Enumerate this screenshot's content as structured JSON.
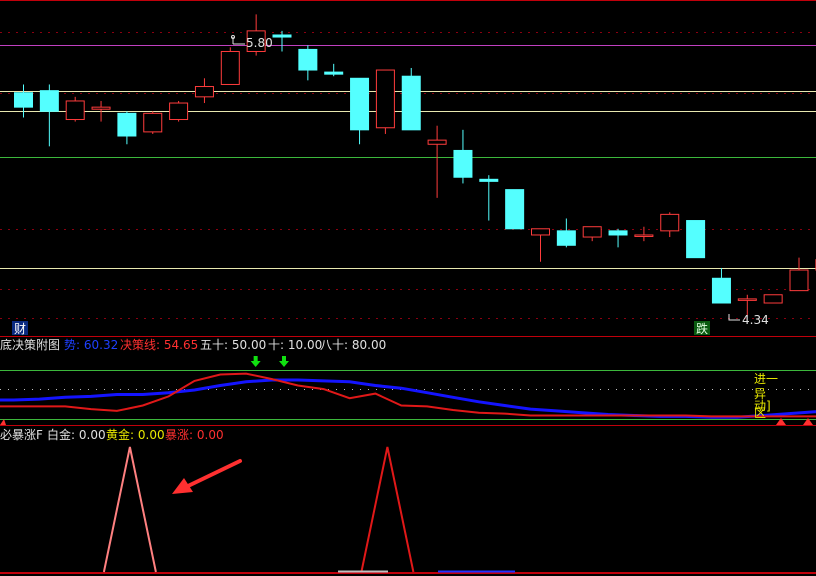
{
  "colors": {
    "background": "#000000",
    "frame": "#c0000b",
    "up": "#ff3c3c",
    "down": "#54ffff",
    "level_magenta": "#c040c0",
    "level_light": "#e8e8b0",
    "level_green": "#3cb83c",
    "blue_line": "#1414ff",
    "red_line": "#e01818",
    "pink_peak": "#ff8080",
    "arrow_green": "#10e010",
    "label_white": "#e0e0e0",
    "label_yellow": "#e8e800",
    "annotation_red": "#ff3030"
  },
  "price_panel": {
    "high_label": "5.80",
    "low_label": "4.34",
    "left_marker": "财",
    "right_marker": "跌"
  },
  "indicator1": {
    "name": "底决策附图",
    "line1_label": "势:",
    "line1_value": "60.32",
    "line2_label": "决策线:",
    "line2_value": "54.65",
    "level50_label": "五十:",
    "level50_value": "50.00",
    "level10_label": "十:",
    "level10_value": "10.00",
    "level80_label": "八十:",
    "level80_value": "80.00",
    "right_note": [
      "进一",
      "异",
      "动]",
      "区"
    ]
  },
  "indicator2": {
    "name": "必暴涨F",
    "baijin_label": "白金:",
    "baijin_value": "0.00",
    "huangjin_label": "黄金:",
    "huangjin_value": "0.00",
    "baozhang_label": "暴涨:",
    "baozhang_value": "0.00"
  },
  "chart_data": {
    "type": "candlestick",
    "candles": [
      {
        "o": 5.42,
        "h": 5.46,
        "l": 5.3,
        "c": 5.35
      },
      {
        "o": 5.43,
        "h": 5.46,
        "l": 5.16,
        "c": 5.33
      },
      {
        "o": 5.29,
        "h": 5.4,
        "l": 5.28,
        "c": 5.38
      },
      {
        "o": 5.34,
        "h": 5.38,
        "l": 5.28,
        "c": 5.35
      },
      {
        "o": 5.32,
        "h": 5.33,
        "l": 5.17,
        "c": 5.21
      },
      {
        "o": 5.23,
        "h": 5.33,
        "l": 5.22,
        "c": 5.32
      },
      {
        "o": 5.29,
        "h": 5.38,
        "l": 5.28,
        "c": 5.37
      },
      {
        "o": 5.4,
        "h": 5.49,
        "l": 5.37,
        "c": 5.45
      },
      {
        "o": 5.46,
        "h": 5.64,
        "l": 5.46,
        "c": 5.62
      },
      {
        "o": 5.62,
        "h": 5.8,
        "l": 5.6,
        "c": 5.72
      },
      {
        "o": 5.7,
        "h": 5.72,
        "l": 5.62,
        "c": 5.69
      },
      {
        "o": 5.63,
        "h": 5.65,
        "l": 5.48,
        "c": 5.53
      },
      {
        "o": 5.52,
        "h": 5.56,
        "l": 5.5,
        "c": 5.51
      },
      {
        "o": 5.49,
        "h": 5.49,
        "l": 5.17,
        "c": 5.24
      },
      {
        "o": 5.25,
        "h": 5.53,
        "l": 5.22,
        "c": 5.53
      },
      {
        "o": 5.5,
        "h": 5.54,
        "l": 5.24,
        "c": 5.24
      },
      {
        "o": 5.17,
        "h": 5.26,
        "l": 4.91,
        "c": 5.19
      },
      {
        "o": 5.14,
        "h": 5.24,
        "l": 4.98,
        "c": 5.01
      },
      {
        "o": 5.0,
        "h": 5.02,
        "l": 4.8,
        "c": 4.99
      },
      {
        "o": 4.95,
        "h": 4.95,
        "l": 4.76,
        "c": 4.76
      },
      {
        "o": 4.73,
        "h": 4.76,
        "l": 4.6,
        "c": 4.76
      },
      {
        "o": 4.75,
        "h": 4.81,
        "l": 4.67,
        "c": 4.68
      },
      {
        "o": 4.72,
        "h": 4.77,
        "l": 4.7,
        "c": 4.77
      },
      {
        "o": 4.75,
        "h": 4.76,
        "l": 4.67,
        "c": 4.73
      },
      {
        "o": 4.73,
        "h": 4.77,
        "l": 4.7,
        "c": 4.73
      },
      {
        "o": 4.75,
        "h": 4.84,
        "l": 4.72,
        "c": 4.83
      },
      {
        "o": 4.8,
        "h": 4.8,
        "l": 4.62,
        "c": 4.62
      },
      {
        "o": 4.52,
        "h": 4.57,
        "l": 4.4,
        "c": 4.4
      },
      {
        "o": 4.42,
        "h": 4.44,
        "l": 4.34,
        "c": 4.42
      },
      {
        "o": 4.4,
        "h": 4.44,
        "l": 4.4,
        "c": 4.44
      },
      {
        "o": 4.46,
        "h": 4.62,
        "l": 4.46,
        "c": 4.56
      },
      {
        "o": 4.56,
        "h": 4.62,
        "l": 4.54,
        "c": 4.61
      }
    ],
    "price_range": [
      4.24,
      5.86
    ],
    "levels": [
      5.65,
      5.43,
      5.33,
      5.11,
      4.57
    ],
    "shi_line": [
      22,
      23,
      25,
      26,
      28,
      28,
      30,
      33,
      38,
      42,
      44,
      44,
      43,
      42,
      38,
      35,
      30,
      25,
      20,
      16,
      12,
      10,
      8,
      6,
      5,
      4,
      4,
      3,
      3,
      5,
      7,
      9
    ],
    "juece_line": [
      15,
      15,
      15,
      12,
      10,
      16,
      26,
      43,
      50,
      51,
      45,
      38,
      34,
      24,
      29,
      16,
      15,
      11,
      8,
      7,
      5,
      5,
      5,
      5,
      5,
      5,
      5,
      4,
      4,
      4,
      4,
      4
    ],
    "indicator1_range": [
      0,
      55
    ],
    "buy_arrows_at": [
      9,
      10
    ],
    "indicator2_peaks": [
      {
        "candle": 4,
        "value": 100,
        "series": "白金"
      },
      {
        "candle": 14,
        "value": 100,
        "series": "暴涨"
      }
    ]
  }
}
